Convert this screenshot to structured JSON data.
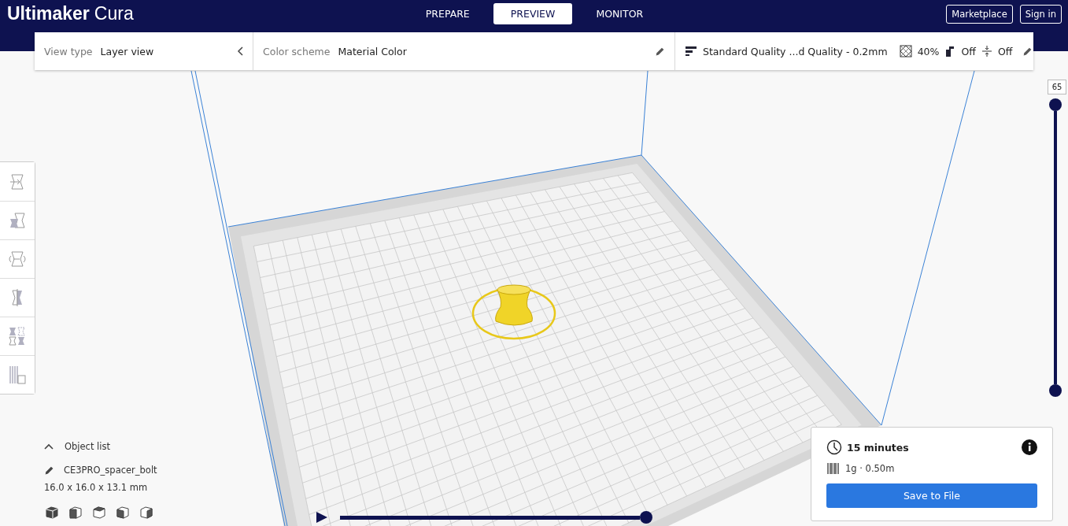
{
  "app": {
    "brand_bold": "Ultimaker",
    "brand_light": "Cura"
  },
  "stages": [
    {
      "label": "PREPARE",
      "selected": false
    },
    {
      "label": "PREVIEW",
      "selected": true
    },
    {
      "label": "MONITOR",
      "selected": false
    }
  ],
  "account_buttons": [
    "Marketplace",
    "Sign in"
  ],
  "view_settings": {
    "view_type": {
      "label": "View type",
      "value": "Layer view"
    },
    "color_scheme": {
      "label": "Color scheme",
      "value": "Material Color"
    }
  },
  "print_settings": {
    "profile": "Standard Quality ...d Quality - 0.2mm",
    "infill": "40%",
    "support": "Off",
    "adhesion": "Off"
  },
  "tools": [
    {
      "kind": "move"
    },
    {
      "kind": "scale"
    },
    {
      "kind": "rotate"
    },
    {
      "kind": "mirror"
    },
    {
      "kind": "per_model"
    },
    {
      "kind": "support_blocker"
    }
  ],
  "object_list": {
    "label": "Object list",
    "expanded": true,
    "object_name": "CE3PRO_spacer_bolt",
    "dimensions": "16.0 x 16.0 x 13.1 mm"
  },
  "layer_slider": {
    "current_layer": "65",
    "level": 1
  },
  "simulation": {
    "level": 1
  },
  "print_summary": {
    "time": "15 minutes",
    "material": "1g · 0.50m",
    "button": "Save to File"
  }
}
